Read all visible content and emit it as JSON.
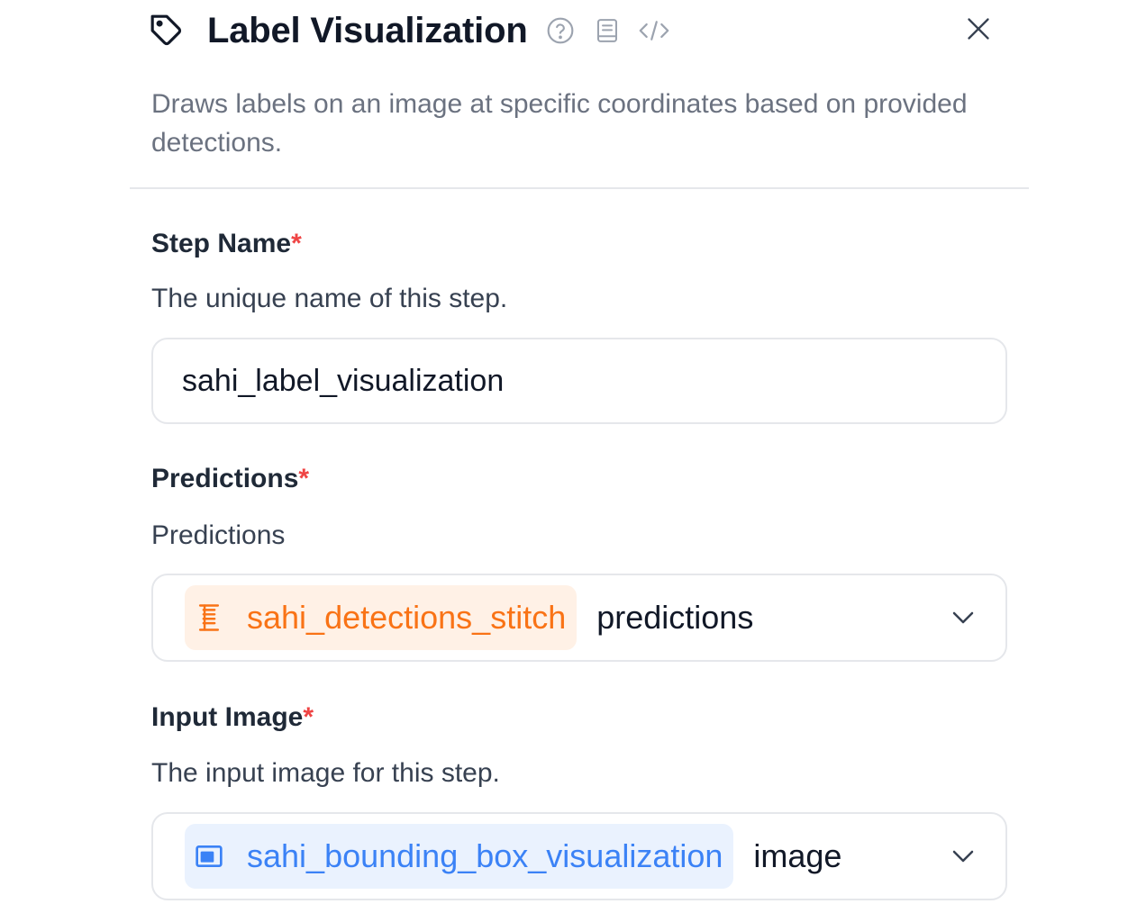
{
  "header": {
    "title": "Label Visualization",
    "icons": [
      "tag-icon",
      "help-circle-icon",
      "docs-icon",
      "code-icon",
      "close-icon"
    ]
  },
  "description": "Draws labels on an image at specific coordinates based on provided detections.",
  "fields": {
    "step_name": {
      "label": "Step Name",
      "required_mark": "*",
      "help": "The unique name of this step.",
      "value": "sahi_label_visualization"
    },
    "predictions": {
      "label": "Predictions",
      "required_mark": "*",
      "help": "Predictions",
      "source_step": "sahi_detections_stitch",
      "source_icon": "stitch-icon",
      "output": "predictions"
    },
    "input_image": {
      "label": "Input Image",
      "required_mark": "*",
      "help": "The input image for this step.",
      "source_step": "sahi_bounding_box_visualization",
      "source_icon": "image-icon",
      "output": "image"
    }
  },
  "colors": {
    "required": "#ef4444",
    "orange_chip_bg": "#fff1e6",
    "orange_chip_text": "#f97316",
    "blue_chip_bg": "#eaf2fe",
    "blue_chip_text": "#3b82f6",
    "muted_text": "#6b7280",
    "border": "#e5e7eb"
  }
}
